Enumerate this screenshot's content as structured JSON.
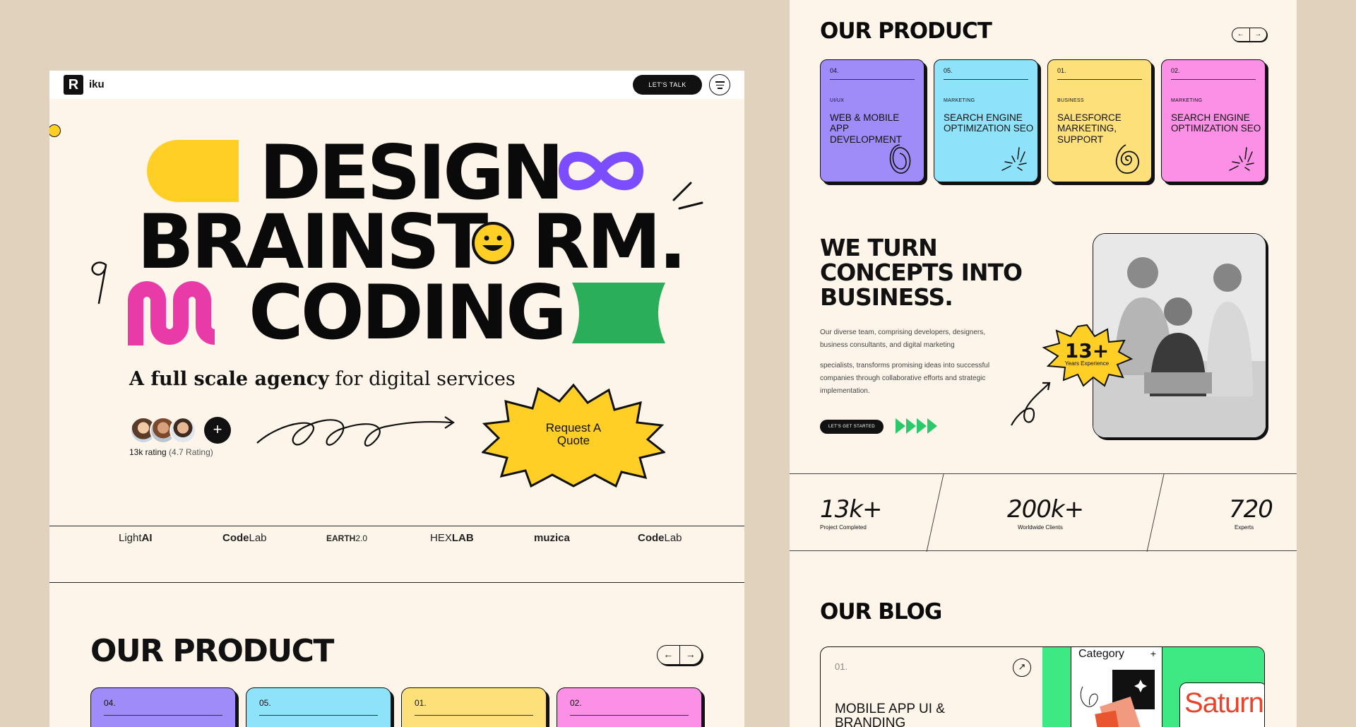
{
  "left": {
    "nav": {
      "logo_text": "iku",
      "talk_label": "LET'S TALK"
    },
    "hero": {
      "line1": "DESIGN",
      "line2a": "BRAINST",
      "line2b": "RM.",
      "line3": "CODING"
    },
    "tagline_bold": "A full scale agency",
    "tagline_rest": " for digital services",
    "rating_count": "13k rating",
    "rating_value": "(4.7 Rating)",
    "avatar_plus": "+",
    "quote_line1": "Request A",
    "quote_line2": "Quote",
    "brands": [
      {
        "a": "Light",
        "b": "AI"
      },
      {
        "a": "Code",
        "b": "Lab"
      },
      {
        "a": "EARTH",
        "b": "2.0"
      },
      {
        "a": "HEX",
        "b": "LAB"
      },
      {
        "a": "muzica",
        "b": ""
      },
      {
        "a": "Code",
        "b": "Lab"
      }
    ],
    "product_title": "OUR PRODUCT",
    "product_cards": [
      {
        "num": "04.",
        "color": "#a08cf9"
      },
      {
        "num": "05.",
        "color": "#8ee3fb"
      },
      {
        "num": "01.",
        "color": "#fde07a"
      },
      {
        "num": "02.",
        "color": "#fc90e6"
      }
    ]
  },
  "right": {
    "product_title": "OUR PRODUCT",
    "arrow_prev": "←",
    "arrow_next": "→",
    "cards": [
      {
        "num": "04.",
        "category": "UI/UX",
        "name": "WEB & MOBILE APP DEVELOPMENT",
        "color": "#a08cf9"
      },
      {
        "num": "05.",
        "category": "MARKETING",
        "name": "SEARCH ENGINE OPTIMIZATION SEO",
        "color": "#8ee3fb"
      },
      {
        "num": "01.",
        "category": "BUSINESS",
        "name": "SALESFORCE MARKETING, SUPPORT",
        "color": "#fde07a"
      },
      {
        "num": "02.",
        "category": "MARKETING",
        "name": "SEARCH ENGINE OPTIMIZATION SEO",
        "color": "#fc90e6"
      }
    ],
    "concept_title": "WE TURN CONCEPTS INTO BUSINESS.",
    "paragraph1": "Our diverse team, comprising developers, designers, business consultants, and digital marketing",
    "paragraph2": "specialists, transforms promising ideas into successful companies through collaborative efforts and strategic implementation.",
    "start_label": "LET'S GET STARTED",
    "badge_num": "13+",
    "badge_label": "Years Experience",
    "stats": [
      {
        "value": "13k+",
        "label": "Project Completed"
      },
      {
        "value": "200k+",
        "label": "Worldwide Clients"
      },
      {
        "value": "720",
        "label": "Experts"
      }
    ],
    "blog_title": "OUR BLOG",
    "blog_num": "01.",
    "blog_name_line1": "MOBILE APP UI &",
    "blog_name_line2": "BRANDING",
    "blog_arrow": "↗",
    "category_label": "Category",
    "category_plus": "+",
    "saturn_text": "Saturn"
  },
  "colors": {
    "yellow": "#ffcf25",
    "purple": "#7b4dff",
    "pink": "#e93ba7",
    "green": "#2bae5a",
    "bright_green": "#3ee882",
    "cream": "#fdf5ea"
  }
}
